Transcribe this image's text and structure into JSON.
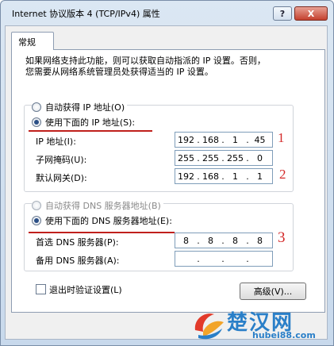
{
  "window": {
    "title": "Internet 协议版本 4 (TCP/IPv4) 属性",
    "help_label": "?",
    "close_label": "X"
  },
  "tabs": [
    {
      "label": "常规",
      "selected": true
    }
  ],
  "description": {
    "line1": "如果网络支持此功能，则可以获取自动指派的 IP 设置。否则，",
    "line2": "您需要从网络系统管理员处获得适当的 IP 设置。"
  },
  "ip_section": {
    "auto_label": "自动获得 IP 地址(O)",
    "manual_label": "使用下面的 IP 地址(S):",
    "manual_selected": true,
    "fields": [
      {
        "label": "IP 地址(I):",
        "octets": [
          "192",
          "168",
          "1",
          "45"
        ],
        "annotation": "1"
      },
      {
        "label": "子网掩码(U):",
        "octets": [
          "255",
          "255",
          "255",
          "0"
        ],
        "annotation": ""
      },
      {
        "label": "默认网关(D):",
        "octets": [
          "192",
          "168",
          "1",
          "1"
        ],
        "annotation": "2"
      }
    ]
  },
  "dns_section": {
    "auto_label": "自动获得 DNS 服务器地址(B)",
    "manual_label": "使用下面的 DNS 服务器地址(E):",
    "manual_selected": true,
    "fields": [
      {
        "label": "首选 DNS 服务器(P):",
        "octets": [
          "8",
          "8",
          "8",
          "8"
        ],
        "annotation": "3"
      },
      {
        "label": "备用 DNS 服务器(A):",
        "octets": [
          "",
          "",
          "",
          ""
        ],
        "annotation": ""
      }
    ]
  },
  "footer": {
    "validate_label": "退出时验证设置(L)",
    "validate_checked": false,
    "advanced_label": "高级(V)..."
  },
  "watermark": {
    "name": "楚汉网",
    "url": "hubei88.com"
  },
  "colors": {
    "annotation_red": "#d42a2a",
    "underline_red": "#c0201c",
    "watermark_blue": "#2a7fc8"
  }
}
